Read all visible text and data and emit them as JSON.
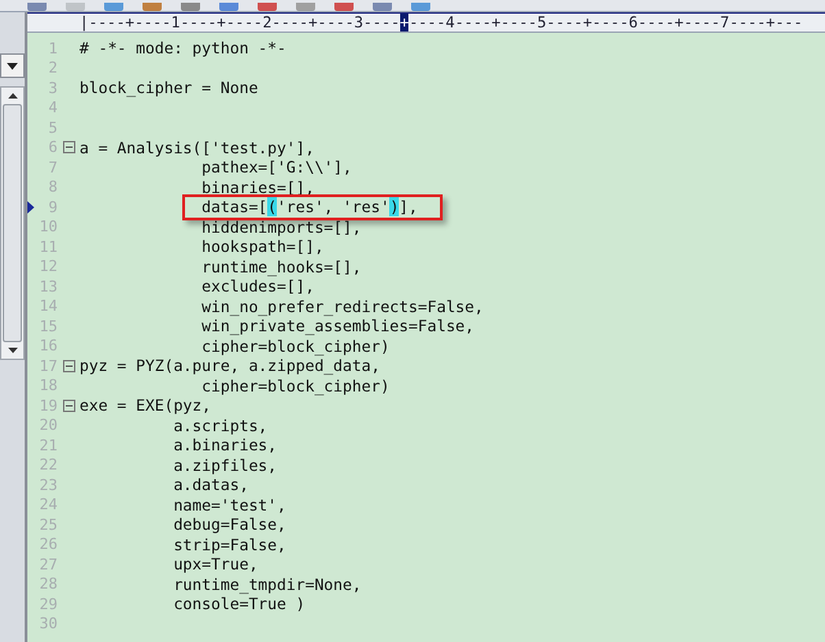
{
  "ruler": {
    "before": "|----+----1----+----2----+----3----",
    "cursor": "+",
    "after": "----4----+----5----+----6----+----7----+---"
  },
  "lines": [
    {
      "number": "1",
      "segments": [
        {
          "kind": "plain",
          "text": "# -*- mode: python -*-"
        }
      ]
    },
    {
      "number": "2"
    },
    {
      "number": "3",
      "segments": [
        {
          "kind": "plain",
          "text": "block_cipher = None"
        }
      ]
    },
    {
      "number": "4"
    },
    {
      "number": "5"
    },
    {
      "number": "6",
      "segments": [
        {
          "kind": "plain",
          "text": "a = Analysis(['test.py'],"
        }
      ],
      "fold": true
    },
    {
      "number": "7",
      "segments": [
        {
          "kind": "plain",
          "text": "             pathex=['G:\\\\'],"
        }
      ]
    },
    {
      "number": "8",
      "segments": [
        {
          "kind": "plain",
          "text": "             binaries=[],"
        }
      ]
    },
    {
      "number": "9",
      "segments": [
        {
          "kind": "plain",
          "text": "             datas=["
        },
        {
          "kind": "brace",
          "text": "("
        },
        {
          "kind": "plain",
          "text": "'res', 'res'"
        },
        {
          "kind": "brace",
          "text": ")"
        },
        {
          "kind": "plain",
          "text": "],"
        }
      ],
      "marker": true,
      "annotated": true
    },
    {
      "number": "10",
      "segments": [
        {
          "kind": "plain",
          "text": "             hiddenimports=[],"
        }
      ]
    },
    {
      "number": "11",
      "segments": [
        {
          "kind": "plain",
          "text": "             hookspath=[],"
        }
      ]
    },
    {
      "number": "12",
      "segments": [
        {
          "kind": "plain",
          "text": "             runtime_hooks=[],"
        }
      ]
    },
    {
      "number": "13",
      "segments": [
        {
          "kind": "plain",
          "text": "             excludes=[],"
        }
      ]
    },
    {
      "number": "14",
      "segments": [
        {
          "kind": "plain",
          "text": "             win_no_prefer_redirects=False,"
        }
      ]
    },
    {
      "number": "15",
      "segments": [
        {
          "kind": "plain",
          "text": "             win_private_assemblies=False,"
        }
      ]
    },
    {
      "number": "16",
      "segments": [
        {
          "kind": "plain",
          "text": "             cipher=block_cipher)"
        }
      ]
    },
    {
      "number": "17",
      "segments": [
        {
          "kind": "plain",
          "text": "pyz = PYZ(a.pure, a.zipped_data,"
        }
      ],
      "fold": true
    },
    {
      "number": "18",
      "segments": [
        {
          "kind": "plain",
          "text": "             cipher=block_cipher)"
        }
      ]
    },
    {
      "number": "19",
      "segments": [
        {
          "kind": "plain",
          "text": "exe = EXE(pyz,"
        }
      ],
      "fold": true
    },
    {
      "number": "20",
      "segments": [
        {
          "kind": "plain",
          "text": "          a.scripts,"
        }
      ]
    },
    {
      "number": "21",
      "segments": [
        {
          "kind": "plain",
          "text": "          a.binaries,"
        }
      ]
    },
    {
      "number": "22",
      "segments": [
        {
          "kind": "plain",
          "text": "          a.zipfiles,"
        }
      ]
    },
    {
      "number": "23",
      "segments": [
        {
          "kind": "plain",
          "text": "          a.datas,"
        }
      ]
    },
    {
      "number": "24",
      "segments": [
        {
          "kind": "plain",
          "text": "          name='test',"
        }
      ]
    },
    {
      "number": "25",
      "segments": [
        {
          "kind": "plain",
          "text": "          debug=False,"
        }
      ]
    },
    {
      "number": "26",
      "segments": [
        {
          "kind": "plain",
          "text": "          strip=False,"
        }
      ]
    },
    {
      "number": "27",
      "segments": [
        {
          "kind": "plain",
          "text": "          upx=True,"
        }
      ]
    },
    {
      "number": "28",
      "segments": [
        {
          "kind": "plain",
          "text": "          runtime_tmpdir=None,"
        }
      ]
    },
    {
      "number": "29",
      "segments": [
        {
          "kind": "plain",
          "text": "          console=True )"
        }
      ]
    },
    {
      "number": "30"
    }
  ]
}
